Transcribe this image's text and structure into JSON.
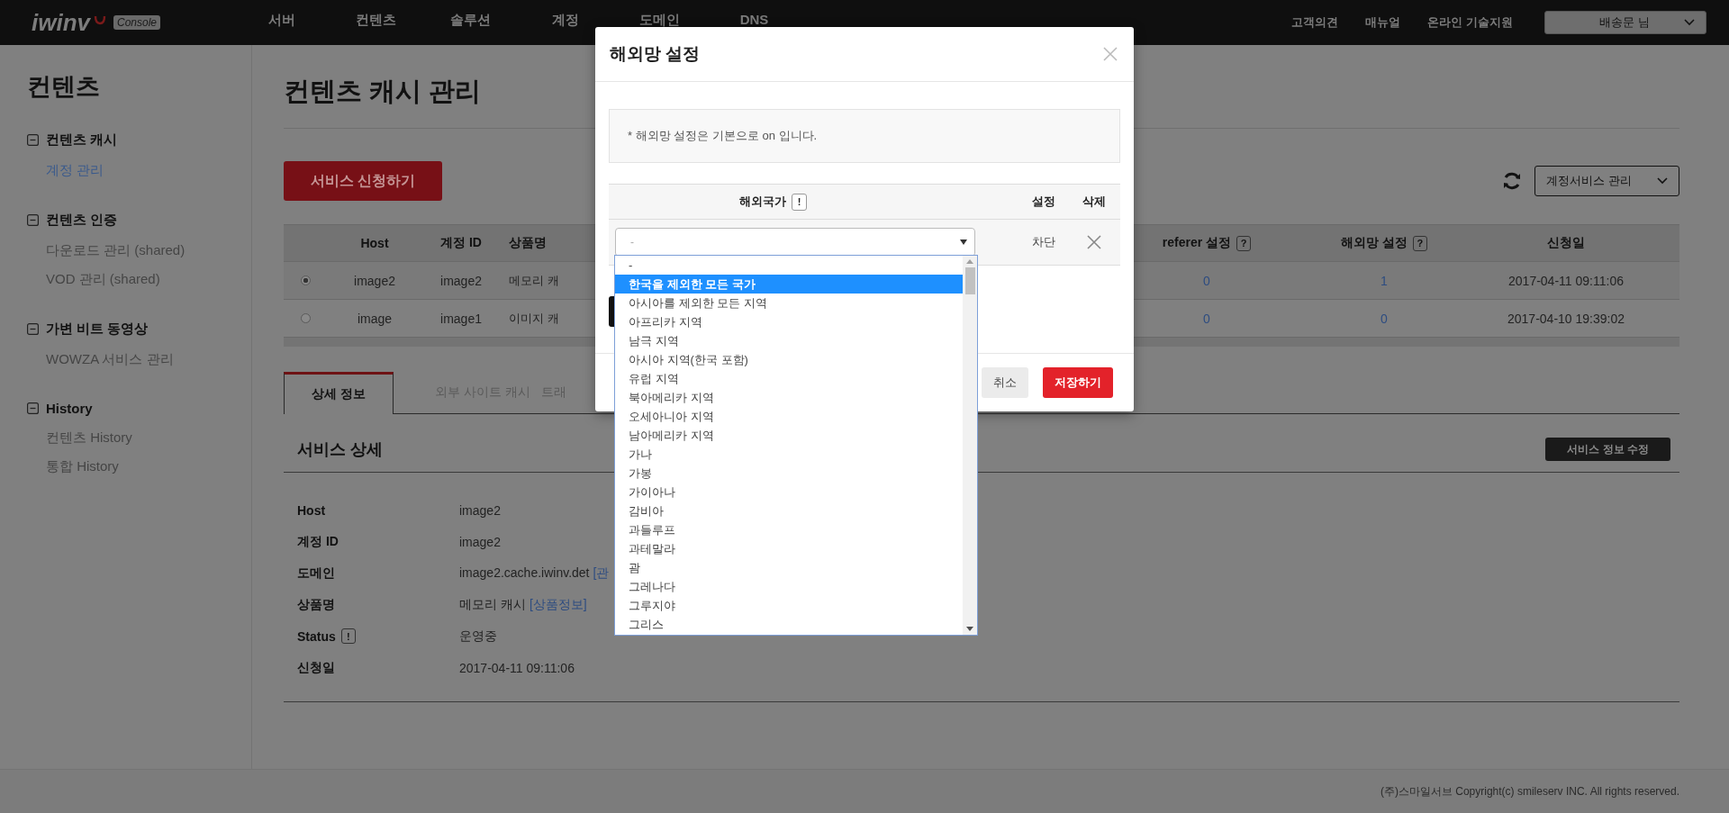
{
  "nav": {
    "logo": "iwinv",
    "badge": "Console",
    "menu": [
      {
        "label": "서버"
      },
      {
        "label": "컨텐츠"
      },
      {
        "label": "솔루션"
      },
      {
        "label": "계정"
      },
      {
        "label": "도메인"
      },
      {
        "label": "DNS"
      }
    ],
    "links": [
      "고객의견",
      "매뉴얼",
      "온라인 기술지원"
    ],
    "user": "배송문 님"
  },
  "sidebar": {
    "title": "컨텐츠",
    "groups": [
      {
        "label": "컨텐츠 캐시",
        "expanded": true,
        "items": [
          {
            "label": "계정 관리",
            "selected": true
          }
        ]
      },
      {
        "label": "컨텐츠 인증",
        "expanded": true,
        "items": [
          {
            "label": "다운로드 관리 (shared)",
            "selected": false
          },
          {
            "label": "VOD 관리 (shared)",
            "selected": false
          }
        ]
      },
      {
        "label": "가변 비트 동영상",
        "expanded": true,
        "items": [
          {
            "label": "WOWZA 서비스 관리",
            "selected": false
          }
        ]
      },
      {
        "label": "History",
        "expanded": true,
        "items": [
          {
            "label": "컨텐츠 History",
            "selected": false
          },
          {
            "label": "통합 History",
            "selected": false
          }
        ]
      }
    ]
  },
  "page": {
    "title": "컨텐츠 캐시 관리",
    "apply_button": "서비스 신청하기",
    "service_select": "계정서비스 관리"
  },
  "table": {
    "columns": [
      {
        "label": "Host"
      },
      {
        "label": "계정 ID"
      },
      {
        "label": "상품명"
      },
      {
        "label": "referer 설정",
        "help": "?"
      },
      {
        "label": "해외망 설정",
        "help": "?"
      },
      {
        "label": "신청일"
      }
    ],
    "rows": [
      {
        "selected": true,
        "cells": [
          "image2",
          "image2",
          "메모리 캐",
          "0",
          "1",
          "2017-04-11 09:11:06"
        ]
      },
      {
        "selected": false,
        "cells": [
          "image",
          "image1",
          "이미지 캐",
          "0",
          "0",
          "2017-04-10 19:39:02"
        ]
      }
    ]
  },
  "tabs": [
    {
      "label": "상세 정보",
      "selected": true
    },
    {
      "label": "외부 사이트 캐시",
      "selected": false
    },
    {
      "label": "트래",
      "selected": false
    }
  ],
  "detail": {
    "title": "서비스 상세",
    "edit_button": "서비스 정보 수정",
    "rows": [
      {
        "label": "Host",
        "value": "image2"
      },
      {
        "label": "계정 ID",
        "value": "image2"
      },
      {
        "label": "도메인",
        "value": "image2.cache.iwinv.det",
        "link": "[관"
      },
      {
        "label": "상품명",
        "value": "메모리 캐시",
        "link": "[상품정보]"
      },
      {
        "label": "Status",
        "help": "!",
        "value": "운영중"
      },
      {
        "label": "신청일",
        "value": "2017-04-11 09:11:06"
      }
    ]
  },
  "footer": "(주)스마일서브 Copyright(c) smileserv INC. All rights reserved.",
  "modal": {
    "title": "해외망 설정",
    "notice": "* 해외망 설정은 기본으로 on 입니다.",
    "columns": [
      {
        "label": "해외국가",
        "help": "!"
      },
      {
        "label": "설정"
      },
      {
        "label": "삭제"
      }
    ],
    "row": {
      "country": "-",
      "setting": "차단"
    },
    "options": [
      {
        "label": "-",
        "selected": false
      },
      {
        "label": "한국을 제외한 모든 국가",
        "selected": true
      },
      {
        "label": "아시아를 제외한 모든 지역",
        "selected": false
      },
      {
        "label": "아프리카 지역",
        "selected": false
      },
      {
        "label": "남극 지역",
        "selected": false
      },
      {
        "label": "아시아 지역(한국 포함)",
        "selected": false
      },
      {
        "label": "유럽 지역",
        "selected": false
      },
      {
        "label": "북아메리카 지역",
        "selected": false
      },
      {
        "label": "오세아니아 지역",
        "selected": false
      },
      {
        "label": "남아메리카 지역",
        "selected": false
      },
      {
        "label": "가나",
        "selected": false
      },
      {
        "label": "가봉",
        "selected": false
      },
      {
        "label": "가이아나",
        "selected": false
      },
      {
        "label": "감비아",
        "selected": false
      },
      {
        "label": "과들루프",
        "selected": false
      },
      {
        "label": "과테말라",
        "selected": false
      },
      {
        "label": "괌",
        "selected": false
      },
      {
        "label": "그레나다",
        "selected": false
      },
      {
        "label": "그루지야",
        "selected": false
      },
      {
        "label": "그리스",
        "selected": false
      }
    ],
    "cancel": "취소",
    "save": "저장하기"
  }
}
